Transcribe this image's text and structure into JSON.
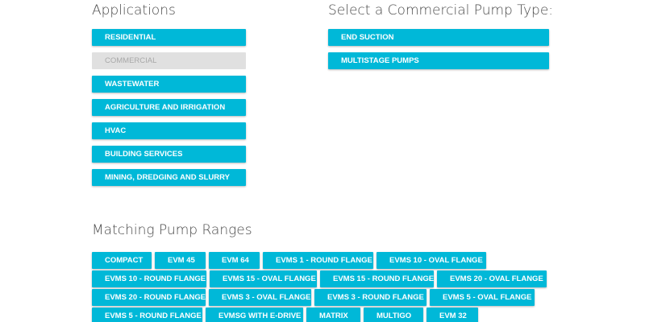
{
  "applications": {
    "heading": "Applications",
    "items": [
      {
        "label": "RESIDENTIAL",
        "disabled": false
      },
      {
        "label": "COMMERCIAL",
        "disabled": true
      },
      {
        "label": "WASTEWATER",
        "disabled": false
      },
      {
        "label": "AGRICULTURE AND IRRIGATION",
        "disabled": false
      },
      {
        "label": "HVAC",
        "disabled": false
      },
      {
        "label": "BUILDING SERVICES",
        "disabled": false
      },
      {
        "label": "MINING, DREDGING AND SLURRY",
        "disabled": false
      }
    ]
  },
  "pump_type": {
    "heading": "Select a Commercial Pump Type:",
    "items": [
      {
        "label": "END SUCTION"
      },
      {
        "label": "MULTISTAGE PUMPS"
      }
    ]
  },
  "ranges": {
    "heading": "Matching Pump Ranges",
    "rows": [
      [
        "COMPACT",
        "EVM 45",
        "EVM 64",
        "EVMS 1 - ROUND FLANGE",
        "EVMS 10 - OVAL FLANGE"
      ],
      [
        "EVMS 10 - ROUND FLANGE",
        "EVMS 15 - OVAL FLANGE",
        "EVMS 15 - ROUND FLANGE",
        "EVMS 20 - OVAL FLANGE"
      ],
      [
        "EVMS 20 - ROUND FLANGE",
        "EVMS 3 - OVAL FLANGE",
        "EVMS 3 - ROUND FLANGE",
        "EVMS 5 - OVAL FLANGE"
      ],
      [
        "EVMS 5 - ROUND FLANGE",
        "EVMSG WITH E-DRIVE",
        "MATRIX",
        "MULTIGO",
        "EVM 32"
      ]
    ]
  }
}
